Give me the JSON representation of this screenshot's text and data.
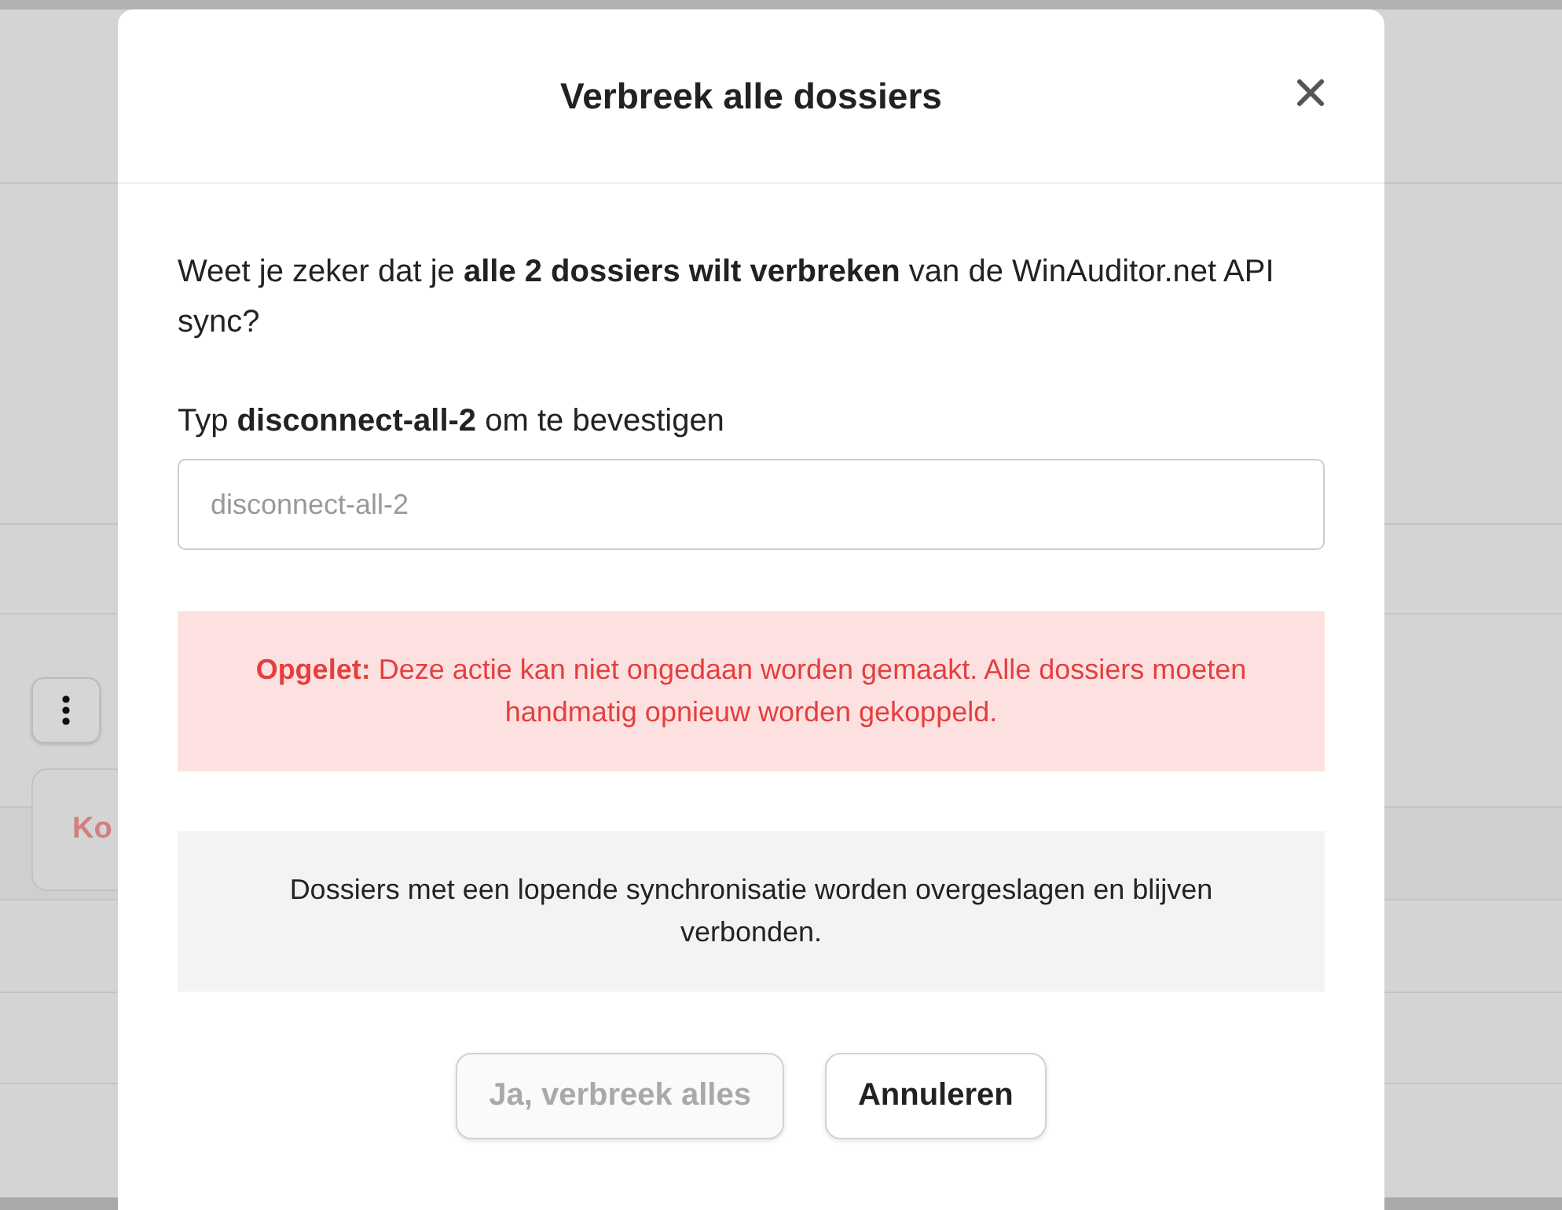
{
  "background": {
    "card_text": "Ko"
  },
  "dialog": {
    "title": "Verbreek alle dossiers",
    "message": "Weet je zeker dat je **alle 2 dossiers wilt verbreken** van de WinAuditor.net API sync?",
    "confirm_label": "Typ **disconnect-all-2** om te bevestigen",
    "confirm_field": {
      "placeholder": "disconnect-all-2"
    },
    "warning": "**Opgelet:** Deze actie kan niet ongedaan worden gemaakt. Alle dossiers moeten handmatig opnieuw worden gekoppeld.",
    "info": "Dossiers met een lopende synchronisatie worden overgeslagen en blijven verbonden.",
    "buttons": [
      {
        "label": "Ja, verbreek alles",
        "disabled": true
      },
      {
        "label": "Annuleren",
        "disabled": false
      }
    ]
  }
}
